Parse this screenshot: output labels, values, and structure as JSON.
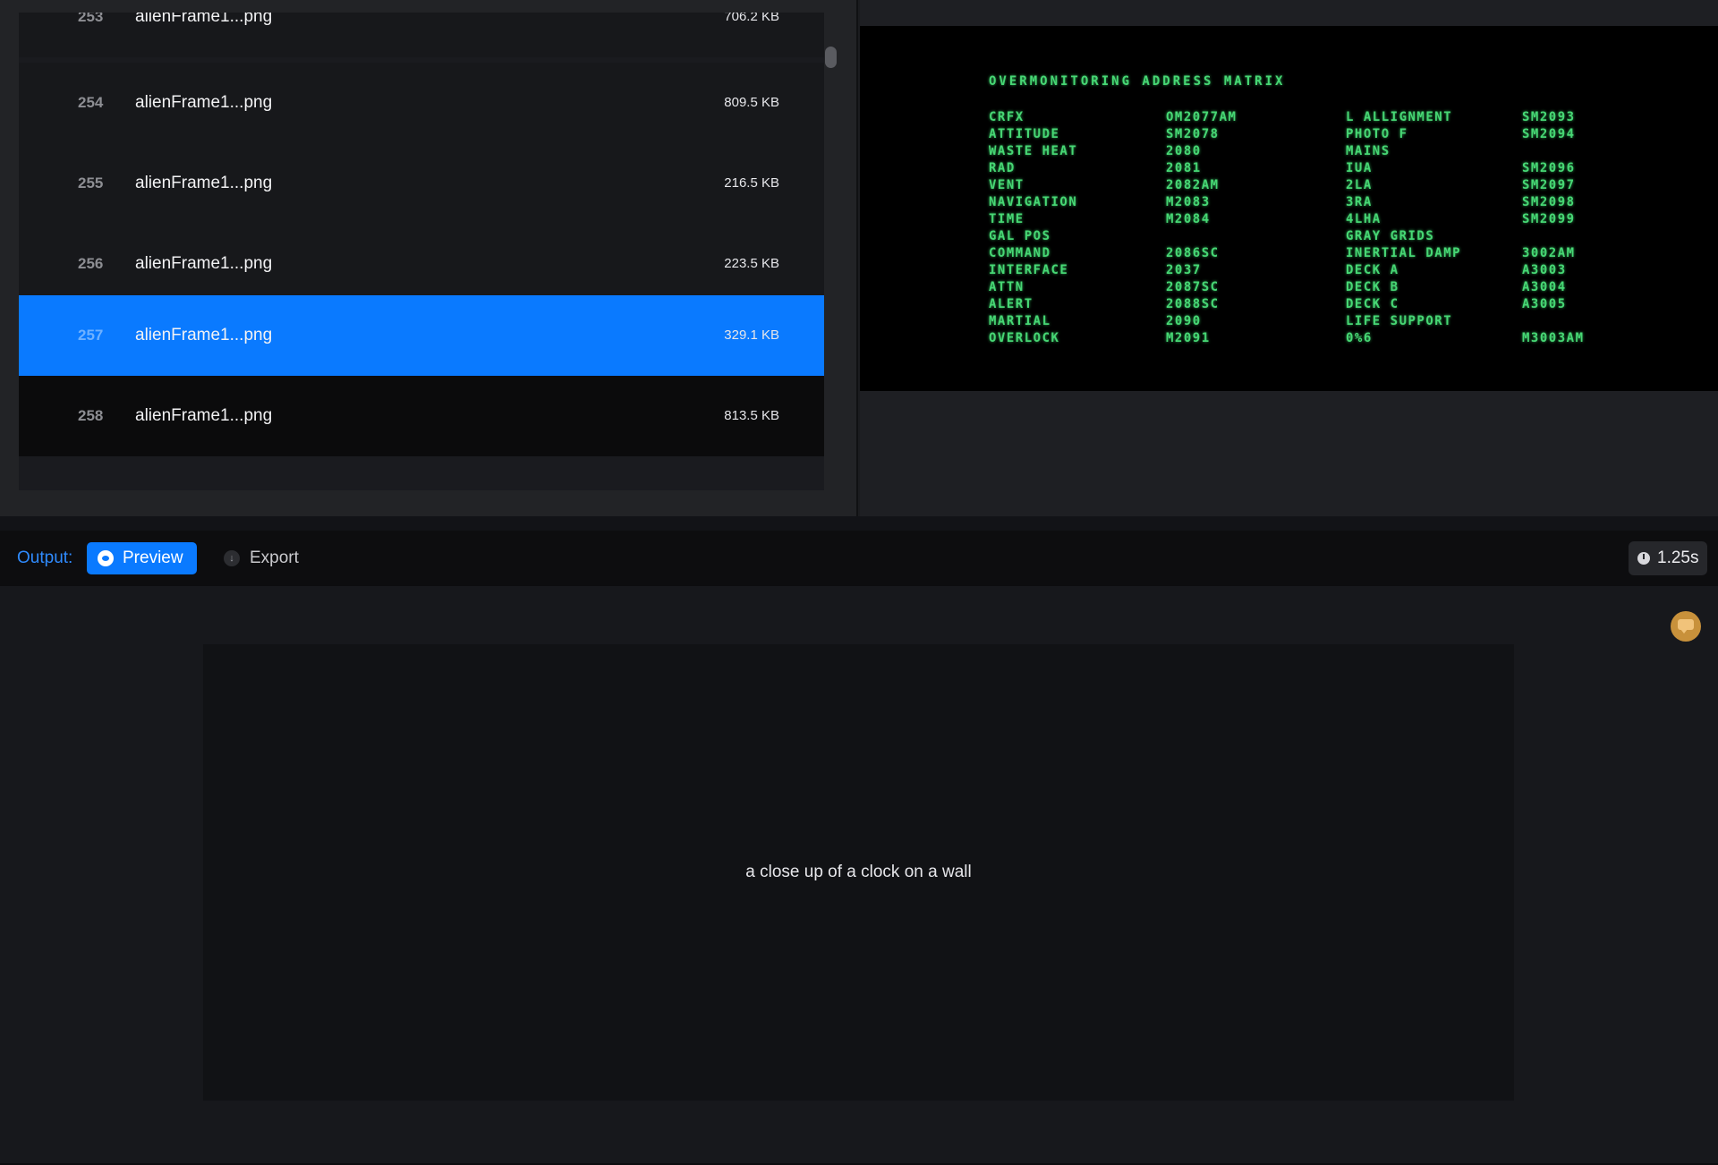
{
  "file_list": {
    "rows": [
      {
        "number": "253",
        "name": "alienFrame1...png",
        "size": "706.2 KB"
      },
      {
        "number": "254",
        "name": "alienFrame1...png",
        "size": "809.5 KB"
      },
      {
        "number": "255",
        "name": "alienFrame1...png",
        "size": "216.5 KB"
      },
      {
        "number": "256",
        "name": "alienFrame1...png",
        "size": "223.5 KB"
      },
      {
        "number": "257",
        "name": "alienFrame1...png",
        "size": "329.1 KB"
      },
      {
        "number": "258",
        "name": "alienFrame1...png",
        "size": "813.5 KB"
      }
    ],
    "selected_number": "257"
  },
  "preview_image": {
    "title": "OVERMONITORING ADDRESS MATRIX",
    "rows": [
      [
        "CRFX",
        "OM2077AM",
        "L ALLIGNMENT",
        "SM2093"
      ],
      [
        "ATTITUDE",
        "SM2078",
        "PHOTO F",
        "SM2094"
      ],
      [
        "WASTE HEAT",
        "2080",
        "MAINS",
        ""
      ],
      [
        "RAD",
        "2081",
        "IUA",
        "SM2096"
      ],
      [
        "VENT",
        "2082AM",
        "2LA",
        "SM2097"
      ],
      [
        "NAVIGATION",
        "M2083",
        "3RA",
        "SM2098"
      ],
      [
        "TIME",
        "M2084",
        "4LHA",
        "SM2099"
      ],
      [
        "GAL POS",
        "",
        "GRAY GRIDS",
        ""
      ],
      [
        "COMMAND",
        "2086SC",
        "INERTIAL DAMP",
        "3002AM"
      ],
      [
        "INTERFACE",
        "2037",
        "DECK A",
        "A3003"
      ],
      [
        "ATTN",
        "2087SC",
        "DECK B",
        "A3004"
      ],
      [
        "ALERT",
        "2088SC",
        "DECK C",
        "A3005"
      ],
      [
        "MARTIAL",
        "2090",
        "LIFE SUPPORT",
        ""
      ],
      [
        "OVERLOCK",
        "M2091",
        "0%6",
        "M3003AM"
      ]
    ]
  },
  "output_bar": {
    "label": "Output:",
    "preview_label": "Preview",
    "export_label": "Export",
    "timing": "1.25s",
    "icons": {
      "preview": "eye-icon",
      "export": "download-icon",
      "timing": "clock-icon",
      "feedback": "chat-bubble-icon"
    }
  },
  "output": {
    "caption": "a close up of a clock on a wall"
  },
  "colors": {
    "accent": "#0a7aff",
    "terminal_text": "#47d774",
    "feedback": "#c8913b"
  }
}
